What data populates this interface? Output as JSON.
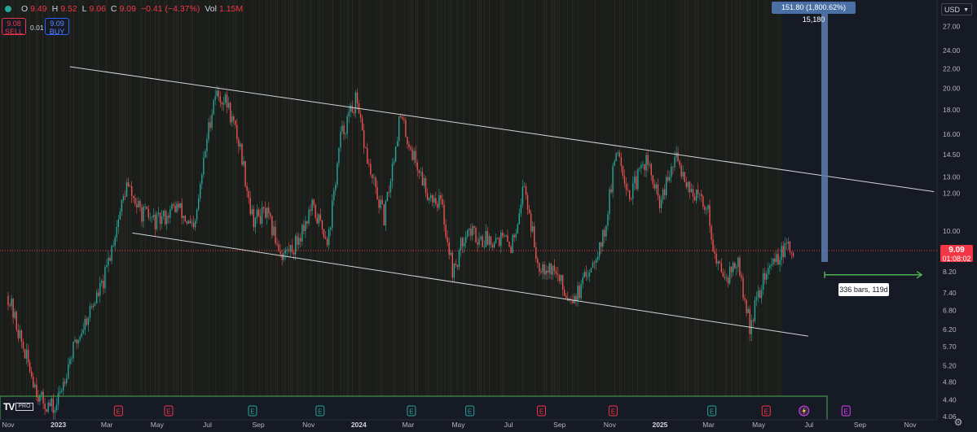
{
  "header": {
    "open_label": "O",
    "open": "9.49",
    "high_label": "H",
    "high": "9.52",
    "low_label": "L",
    "low": "9.06",
    "close_label": "C",
    "close": "9.09",
    "change": "−0.41 (−4.37%)",
    "vol_label": "Vol",
    "vol": "1.15M"
  },
  "trade": {
    "sell_price": "9.08",
    "sell_label": "SELL",
    "qty": "0.01",
    "buy_price": "9.09",
    "buy_label": "BUY"
  },
  "currency": "USD",
  "last_price": {
    "value": "9.09",
    "countdown": "01:08:02"
  },
  "measure_label": "151.80 (1,800.62%) 15,180",
  "range_label": "336 bars, 119d",
  "logo_badge": "PRO",
  "icons": [
    "symbol-status-icon",
    "currency-chevron-icon",
    "earnings-icon",
    "dividend-lightning-icon",
    "settings-icon"
  ],
  "colors": {
    "up": "#26a69a",
    "down": "#ef5350",
    "price_tag": "#f23645",
    "trendline": "#d1d4dc",
    "measure": "#5d7fae",
    "range": "#4caf50",
    "earnings_up": "#26a69a",
    "earnings_down": "#f23645",
    "earnings_future": "#e040fb"
  },
  "chart_data": {
    "type": "candlestick",
    "x_ticks": [
      "Nov",
      "2023",
      "Mar",
      "May",
      "Jul",
      "Sep",
      "Nov",
      "2024",
      "Mar",
      "May",
      "Jul",
      "Sep",
      "Nov",
      "2025",
      "Mar",
      "May",
      "Jul",
      "Sep",
      "Nov"
    ],
    "x_tick_dates": [
      "2022-11-01",
      "2023-01-01",
      "2023-03-01",
      "2023-05-01",
      "2023-07-01",
      "2023-09-01",
      "2023-11-01",
      "2024-01-01",
      "2024-03-01",
      "2024-05-01",
      "2024-07-01",
      "2024-09-01",
      "2024-11-01",
      "2025-01-01",
      "2025-03-01",
      "2025-05-01",
      "2025-07-01",
      "2025-09-01",
      "2025-11-01"
    ],
    "y_ticks": [
      27.0,
      24.0,
      22.0,
      20.0,
      18.0,
      16.0,
      14.5,
      13.0,
      12.0,
      10.0,
      9.09,
      8.2,
      7.4,
      6.8,
      6.2,
      5.7,
      5.2,
      4.8,
      4.4,
      4.06
    ],
    "y_scale": "log",
    "ylim": [
      4.06,
      29.5
    ],
    "last_close": 9.09,
    "price_path": [
      [
        "2022-11-01",
        7.3
      ],
      [
        "2022-11-20",
        5.6
      ],
      [
        "2022-12-10",
        4.4
      ],
      [
        "2022-12-28",
        4.2
      ],
      [
        "2023-01-15",
        5.4
      ],
      [
        "2023-02-05",
        6.6
      ],
      [
        "2023-02-25",
        7.8
      ],
      [
        "2023-03-10",
        9.8
      ],
      [
        "2023-03-25",
        12.5
      ],
      [
        "2023-04-10",
        11.0
      ],
      [
        "2023-05-01",
        10.4
      ],
      [
        "2023-05-25",
        11.3
      ],
      [
        "2023-06-15",
        9.9
      ],
      [
        "2023-06-30",
        15.5
      ],
      [
        "2023-07-10",
        19.6
      ],
      [
        "2023-07-25",
        18.6
      ],
      [
        "2023-08-10",
        15.0
      ],
      [
        "2023-08-25",
        10.6
      ],
      [
        "2023-09-10",
        10.9
      ],
      [
        "2023-09-30",
        8.9
      ],
      [
        "2023-10-15",
        9.3
      ],
      [
        "2023-11-05",
        11.2
      ],
      [
        "2023-11-25",
        9.6
      ],
      [
        "2023-12-10",
        15.8
      ],
      [
        "2023-12-28",
        18.8
      ],
      [
        "2024-01-15",
        13.2
      ],
      [
        "2024-02-01",
        10.6
      ],
      [
        "2024-02-20",
        17.5
      ],
      [
        "2024-03-05",
        14.8
      ],
      [
        "2024-03-25",
        12.0
      ],
      [
        "2024-04-10",
        11.5
      ],
      [
        "2024-04-25",
        8.1
      ],
      [
        "2024-05-10",
        10.1
      ],
      [
        "2024-05-30",
        9.6
      ],
      [
        "2024-06-20",
        9.7
      ],
      [
        "2024-07-05",
        9.3
      ],
      [
        "2024-07-20",
        12.6
      ],
      [
        "2024-08-05",
        8.6
      ],
      [
        "2024-08-25",
        8.3
      ],
      [
        "2024-09-10",
        7.3
      ],
      [
        "2024-09-25",
        7.4
      ],
      [
        "2024-10-10",
        8.6
      ],
      [
        "2024-10-25",
        9.8
      ],
      [
        "2024-11-10",
        15.2
      ],
      [
        "2024-11-25",
        11.8
      ],
      [
        "2024-12-15",
        14.2
      ],
      [
        "2025-01-01",
        11.3
      ],
      [
        "2025-01-20",
        14.3
      ],
      [
        "2025-02-10",
        12.0
      ],
      [
        "2025-02-28",
        11.2
      ],
      [
        "2025-03-10",
        8.5
      ],
      [
        "2025-03-25",
        8.1
      ],
      [
        "2025-04-05",
        8.6
      ],
      [
        "2025-04-20",
        6.3
      ],
      [
        "2025-05-05",
        7.8
      ],
      [
        "2025-05-20",
        8.7
      ],
      [
        "2025-06-05",
        9.2
      ],
      [
        "2025-06-12",
        9.09
      ]
    ],
    "trendlines": [
      {
        "name": "channel-top",
        "from": [
          "2023-01-15",
          22.2
        ],
        "to": [
          "2025-11-30",
          12.1
        ]
      },
      {
        "name": "channel-bottom",
        "from": [
          "2023-04-01",
          9.9
        ],
        "to": [
          "2025-06-30",
          6.0
        ]
      }
    ],
    "measure": {
      "date": "2025-07-20",
      "from": 8.6,
      "to": 29.5
    },
    "date_range": {
      "from": "2025-07-20",
      "to": "2025-11-15",
      "price": 8.08
    },
    "earnings_markers": [
      {
        "date": "2023-03-15",
        "kind": "down"
      },
      {
        "date": "2023-05-15",
        "kind": "down"
      },
      {
        "date": "2023-08-25",
        "kind": "up"
      },
      {
        "date": "2023-11-15",
        "kind": "up"
      },
      {
        "date": "2024-03-05",
        "kind": "up"
      },
      {
        "date": "2024-05-15",
        "kind": "up"
      },
      {
        "date": "2024-08-10",
        "kind": "down"
      },
      {
        "date": "2024-11-05",
        "kind": "down"
      },
      {
        "date": "2025-03-05",
        "kind": "up"
      },
      {
        "date": "2025-05-10",
        "kind": "down"
      },
      {
        "date": "2025-06-25",
        "kind": "dividend"
      },
      {
        "date": "2025-08-15",
        "kind": "future"
      }
    ]
  }
}
